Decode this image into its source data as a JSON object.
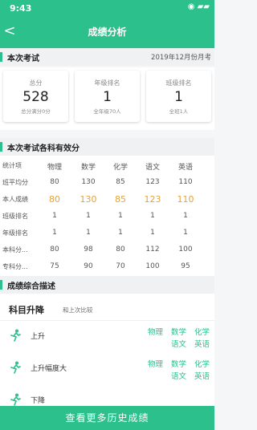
{
  "status": {
    "time": "9:43",
    "icons": "◉ ▰▰"
  },
  "header": {
    "back": "<",
    "title": "成绩分析"
  },
  "section1": {
    "label": "本次考试",
    "date": "2019年12月份月考"
  },
  "cards": [
    {
      "title": "总分",
      "value": "528",
      "sub": "总分满分0分"
    },
    {
      "title": "年级排名",
      "value": "1",
      "sub": "全年级70人"
    },
    {
      "title": "班级排名",
      "value": "1",
      "sub": "全班1人"
    }
  ],
  "section2": {
    "label": "本次考试各科有效分"
  },
  "table": {
    "headers": [
      "统计项",
      "物理",
      "数学",
      "化学",
      "语文",
      "英语"
    ],
    "rows": [
      {
        "label": "班平均分",
        "values": [
          "80",
          "130",
          "85",
          "123",
          "110"
        ]
      },
      {
        "label": "本人成绩",
        "values": [
          "80",
          "130",
          "85",
          "123",
          "110"
        ]
      },
      {
        "label": "班级排名",
        "values": [
          "1",
          "1",
          "1",
          "1",
          "1"
        ]
      },
      {
        "label": "年级排名",
        "values": [
          "1",
          "1",
          "1",
          "1",
          "1"
        ]
      },
      {
        "label": "本科分...",
        "values": [
          "80",
          "98",
          "80",
          "112",
          "100"
        ]
      },
      {
        "label": "专科分...",
        "values": [
          "75",
          "90",
          "70",
          "100",
          "95"
        ]
      }
    ]
  },
  "section3": {
    "label": "成绩综合描述"
  },
  "compare": {
    "title": "科目升降",
    "subtitle": "和上次比较",
    "rows": [
      {
        "label": "上升",
        "subjects": [
          "物理",
          "数学",
          "化学",
          "语文",
          "英语"
        ]
      },
      {
        "label": "上升幅度大",
        "subjects": [
          "物理",
          "数学",
          "化学",
          "语文",
          "英语"
        ]
      },
      {
        "label": "下降",
        "subjects": []
      }
    ]
  },
  "bottom": {
    "label": "查看更多历史成绩"
  },
  "colors": {
    "brand": "#2cc08c",
    "highlight": "#e6a23c"
  }
}
